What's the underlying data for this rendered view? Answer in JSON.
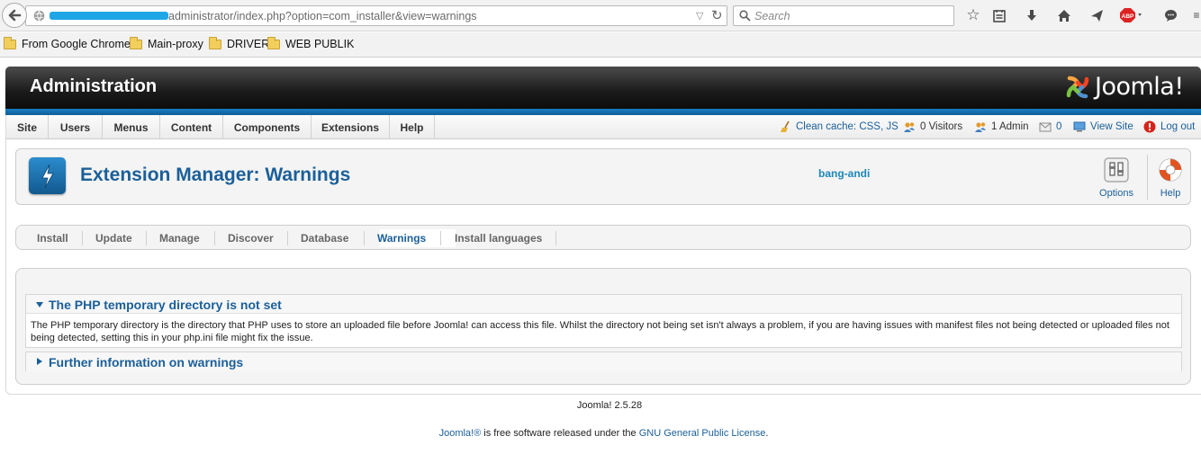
{
  "browser": {
    "url_path": "administrator/index.php?option=com_installer&view=warnings",
    "search_placeholder": "Search",
    "bookmarks": [
      "From Google Chrome",
      "Main-proxy",
      "DRIVER",
      "WEB PUBLIK"
    ]
  },
  "header": {
    "title": "Administration",
    "logo_text": "Joomla!"
  },
  "menu": {
    "items": [
      "Site",
      "Users",
      "Menus",
      "Content",
      "Components",
      "Extensions",
      "Help"
    ]
  },
  "status": {
    "clean_cache": "Clean cache: CSS, JS",
    "visitors": "0 Visitors",
    "admins": "1 Admin",
    "messages": "0",
    "view_site": "View Site",
    "logout": "Log out"
  },
  "toolbar": {
    "page_title": "Extension Manager: Warnings",
    "user": "bang-andi",
    "options_label": "Options",
    "help_label": "Help"
  },
  "submenu": {
    "items": [
      "Install",
      "Update",
      "Manage",
      "Discover",
      "Database",
      "Warnings",
      "Install languages"
    ],
    "active": "Warnings"
  },
  "warnings": [
    {
      "title": "The PHP temporary directory is not set",
      "body": "The PHP temporary directory is the directory that PHP uses to store an uploaded file before Joomla! can access this file. Whilst the directory not being set isn't always a problem, if you are having issues with manifest files not being detected or uploaded files not being detected, setting this in your php.ini file might fix the issue.",
      "expanded": true
    },
    {
      "title": "Further information on warnings",
      "expanded": false
    }
  ],
  "footer": {
    "version": "Joomla! 2.5.28",
    "license_link1": "Joomla!®",
    "license_text": " is free software released under the ",
    "license_link2": "GNU General Public License",
    "license_end": "."
  },
  "colors": {
    "joomla_blue": "#1b5f99",
    "header_dark": "#1a1a1a",
    "strip_blue": "#1a7ec0"
  }
}
